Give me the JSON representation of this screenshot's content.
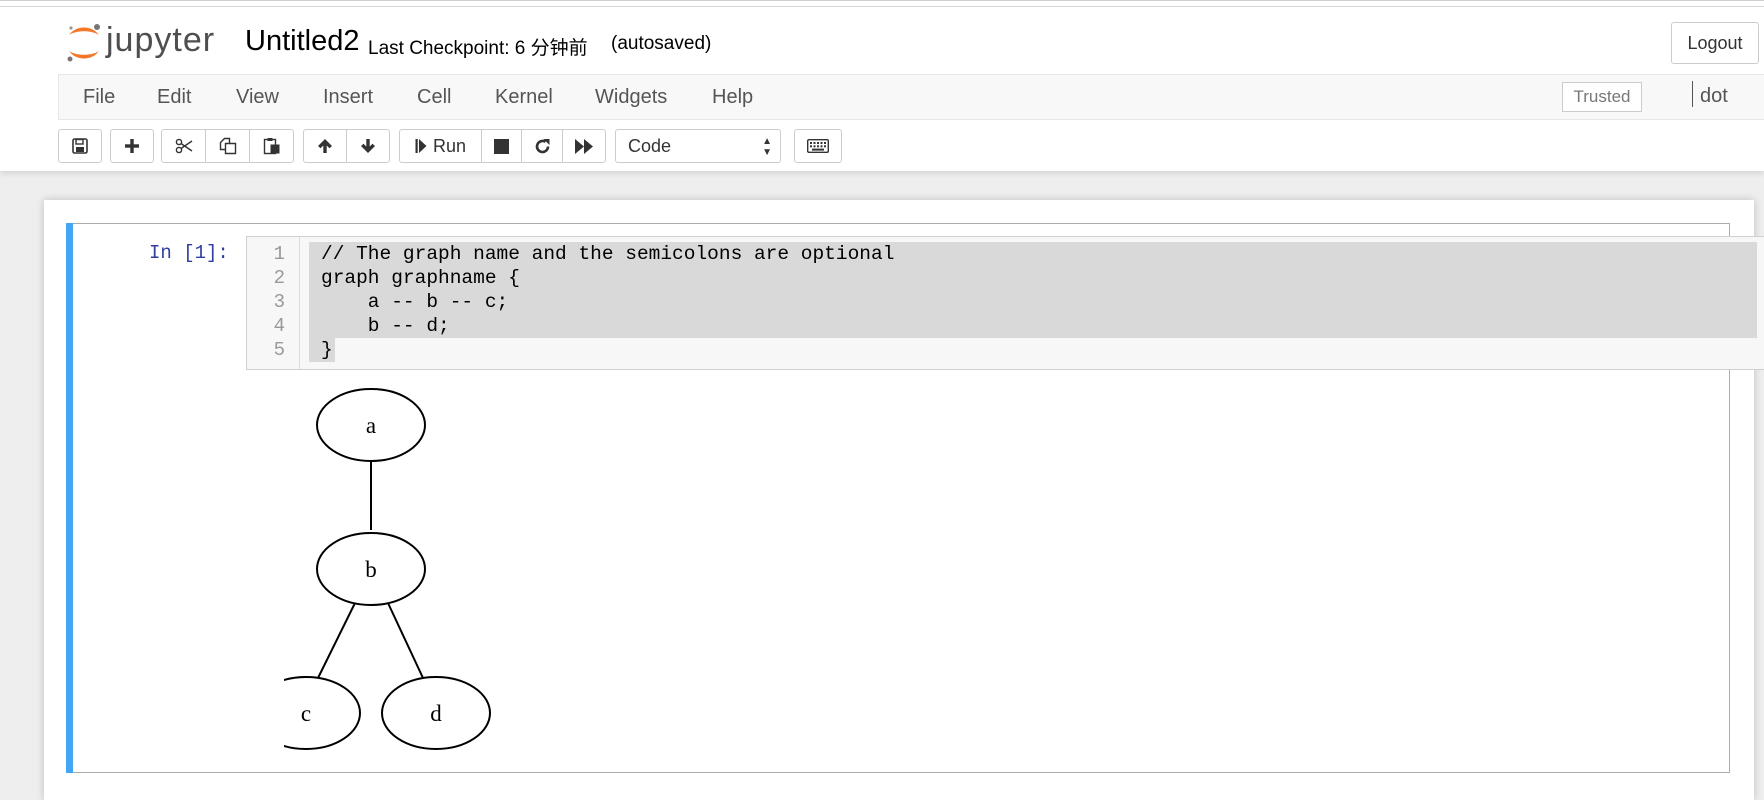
{
  "app": {
    "logo_text": "jupyter",
    "notebook_name": "Untitled2",
    "checkpoint": "Last Checkpoint: 6 分钟前",
    "autosave": "(autosaved)",
    "logout_label": "Logout"
  },
  "menu": {
    "items": [
      "File",
      "Edit",
      "View",
      "Insert",
      "Cell",
      "Kernel",
      "Widgets",
      "Help"
    ],
    "trusted_label": "Trusted",
    "kernel_name": "dot"
  },
  "toolbar": {
    "run_label": "Run",
    "cell_type": "Code"
  },
  "cell": {
    "prompt": "In [1]:",
    "line_numbers": [
      "1",
      "2",
      "3",
      "4",
      "5"
    ],
    "code_lines": [
      "// The graph name and the semicolons are optional",
      "graph graphname {",
      "    a -- b -- c;",
      "    b -- d;",
      "}"
    ]
  },
  "graph": {
    "nodes": [
      "a",
      "b",
      "c",
      "d"
    ],
    "edges": [
      [
        "a",
        "b"
      ],
      [
        "b",
        "c"
      ],
      [
        "b",
        "d"
      ]
    ]
  },
  "colors": {
    "cell_selected_bar": "#42a5f5",
    "prompt_color": "#303f9f",
    "logo_orange": "#f37726"
  }
}
